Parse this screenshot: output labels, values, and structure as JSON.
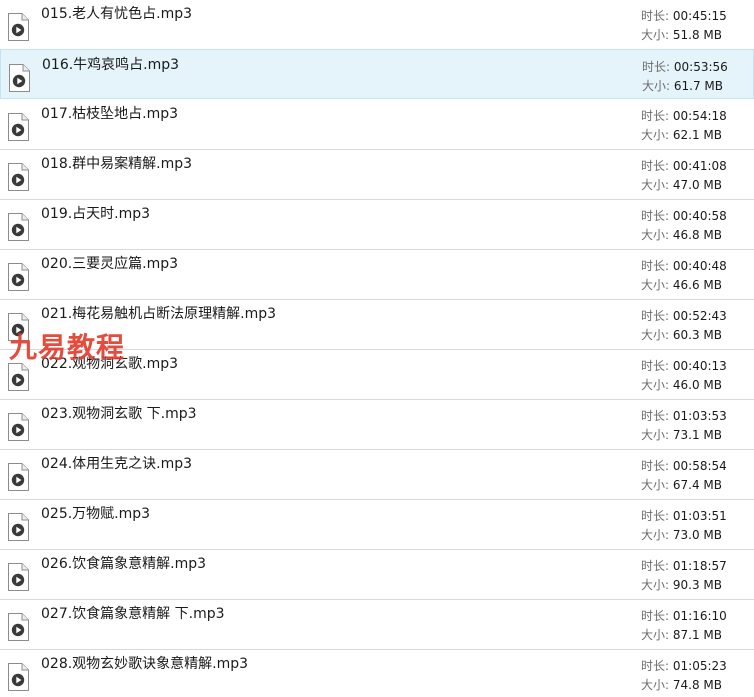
{
  "labels": {
    "duration": "时长:",
    "size": "大小:"
  },
  "watermark": "九易教程",
  "selected_index": 1,
  "files": [
    {
      "name": "015.老人有忧色占.mp3",
      "duration": "00:45:15",
      "size": "51.8 MB"
    },
    {
      "name": "016.牛鸡哀鸣占.mp3",
      "duration": "00:53:56",
      "size": "61.7 MB"
    },
    {
      "name": "017.枯枝坠地占.mp3",
      "duration": "00:54:18",
      "size": "62.1 MB"
    },
    {
      "name": "018.群中易案精解.mp3",
      "duration": "00:41:08",
      "size": "47.0 MB"
    },
    {
      "name": "019.占天时.mp3",
      "duration": "00:40:58",
      "size": "46.8 MB"
    },
    {
      "name": "020.三要灵应篇.mp3",
      "duration": "00:40:48",
      "size": "46.6 MB"
    },
    {
      "name": "021.梅花易触机占断法原理精解.mp3",
      "duration": "00:52:43",
      "size": "60.3 MB"
    },
    {
      "name": "022.观物洞玄歌.mp3",
      "duration": "00:40:13",
      "size": "46.0 MB"
    },
    {
      "name": "023.观物洞玄歌 下.mp3",
      "duration": "01:03:53",
      "size": "73.1 MB"
    },
    {
      "name": "024.体用生克之诀.mp3",
      "duration": "00:58:54",
      "size": "67.4 MB"
    },
    {
      "name": "025.万物赋.mp3",
      "duration": "01:03:51",
      "size": "73.0 MB"
    },
    {
      "name": "026.饮食篇象意精解.mp3",
      "duration": "01:18:57",
      "size": "90.3 MB"
    },
    {
      "name": "027.饮食篇象意精解 下.mp3",
      "duration": "01:16:10",
      "size": "87.1 MB"
    },
    {
      "name": "028.观物玄妙歌诀象意精解.mp3",
      "duration": "01:05:23",
      "size": "74.8 MB"
    }
  ]
}
